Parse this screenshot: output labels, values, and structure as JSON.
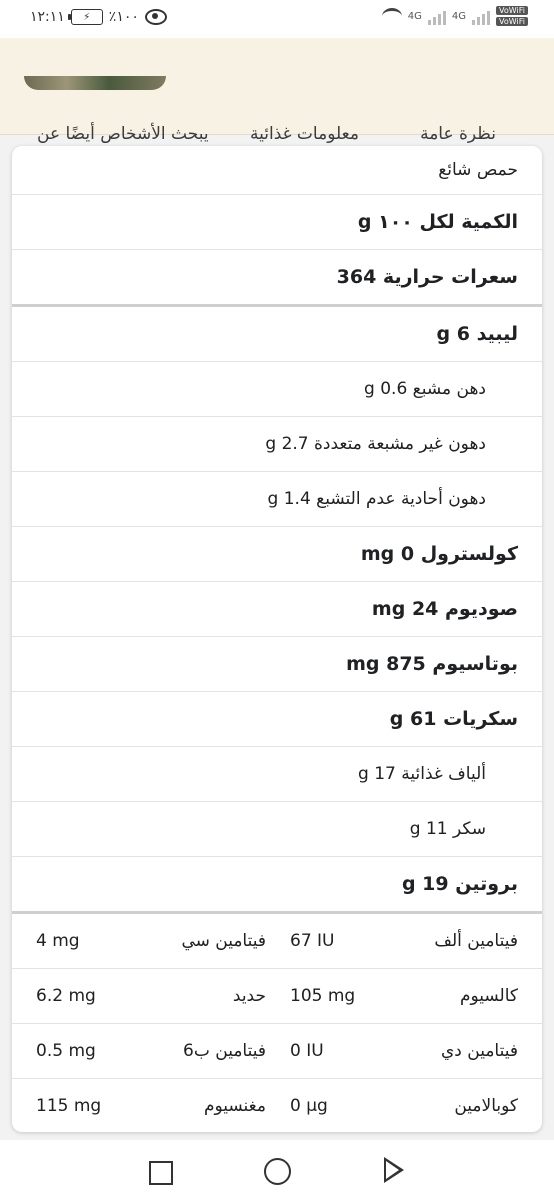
{
  "status_bar": {
    "time": "١٢:١١",
    "battery": "٪١٠٠",
    "network_left": "4G",
    "network_right": "4G",
    "volte_1": "VoWiFi",
    "volte_2": "VoWiFi"
  },
  "tabs": [
    {
      "label": "نظرة عامة"
    },
    {
      "label": "معلومات غذائية"
    },
    {
      "label": "يبحث الأشخاص أيضًا عن"
    }
  ],
  "nutrition": {
    "food_name": "حمص شائع",
    "serving": "الكمية لكل ١٠٠ g",
    "calories": "سعرات حرارية 364",
    "rows": [
      {
        "text": "ليبيد 6 g",
        "bold": true
      },
      {
        "text": "دهن مشبع 0.6 g",
        "bold": false
      },
      {
        "text": "دهون غير مشبعة متعددة 2.7 g",
        "bold": false
      },
      {
        "text": "دهون أحادية عدم التشبع 1.4 g",
        "bold": false
      },
      {
        "text": "كولسترول 0 mg",
        "bold": true
      },
      {
        "text": "صوديوم 24 mg",
        "bold": true
      },
      {
        "text": "بوتاسيوم 875 mg",
        "bold": true
      },
      {
        "text": "سكريات 61 g",
        "bold": true
      },
      {
        "text": "ألياف غذائية 17 g",
        "bold": false
      },
      {
        "text": "سكر 11 g",
        "bold": false
      },
      {
        "text": "بروتين 19 g",
        "bold": true
      }
    ],
    "vitamins": [
      {
        "name1": "فيتامين ألف",
        "value1": "67 IU",
        "name2": "فيتامين سي",
        "value2": "4 mg"
      },
      {
        "name1": "كالسيوم",
        "value1": "105 mg",
        "name2": "حديد",
        "value2": "6.2 mg"
      },
      {
        "name1": "فيتامين دي",
        "value1": "0 IU",
        "name2": "فيتامين ب6",
        "value2": "0.5 mg"
      },
      {
        "name1": "كوبالامين",
        "value1": "0 µg",
        "name2": "مغنسيوم",
        "value2": "115 mg"
      }
    ]
  }
}
